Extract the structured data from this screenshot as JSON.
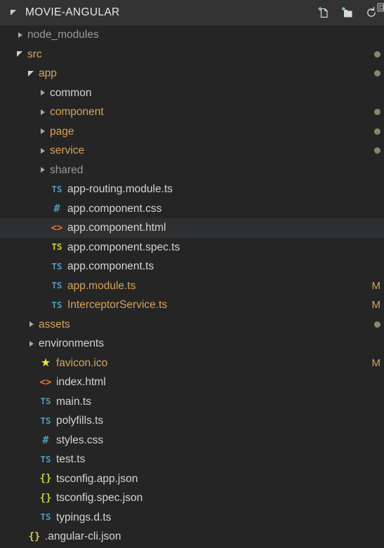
{
  "header": {
    "title": "MOVIE-ANGULAR",
    "twisty": "expanded-twisty-icon",
    "actions": [
      {
        "name": "new-file-icon",
        "label": "New File"
      },
      {
        "name": "new-folder-icon",
        "label": "New Folder"
      },
      {
        "name": "refresh-icon",
        "label": "Refresh Explorer"
      },
      {
        "name": "collapse-all-icon",
        "label": "Collapse Folders in Explorer"
      }
    ]
  },
  "tree": {
    "rows": [
      {
        "label": "node_modules",
        "indent": 1,
        "twisty": "collapsed",
        "icon": "",
        "color": "c-dim",
        "badge": "",
        "dot": false
      },
      {
        "label": "src",
        "indent": 1,
        "twisty": "expanded",
        "icon": "",
        "color": "c-modified",
        "badge": "",
        "dot": true
      },
      {
        "label": "app",
        "indent": 2,
        "twisty": "expanded",
        "icon": "",
        "color": "c-modified",
        "badge": "",
        "dot": true
      },
      {
        "label": "common",
        "indent": 3,
        "twisty": "collapsed",
        "icon": "",
        "color": "c-plain",
        "badge": "",
        "dot": false
      },
      {
        "label": "component",
        "indent": 3,
        "twisty": "collapsed",
        "icon": "",
        "color": "c-modified",
        "badge": "",
        "dot": true
      },
      {
        "label": "page",
        "indent": 3,
        "twisty": "collapsed",
        "icon": "",
        "color": "c-modified",
        "badge": "",
        "dot": true
      },
      {
        "label": "service",
        "indent": 3,
        "twisty": "collapsed",
        "icon": "",
        "color": "c-modified",
        "badge": "",
        "dot": true
      },
      {
        "label": "shared",
        "indent": 3,
        "twisty": "collapsed",
        "icon": "",
        "color": "c-dim",
        "badge": "",
        "dot": false
      },
      {
        "label": "app-routing.module.ts",
        "indent": 3,
        "twisty": "none",
        "icon": "ts",
        "color": "c-plain",
        "badge": "",
        "dot": false
      },
      {
        "label": "app.component.css",
        "indent": 3,
        "twisty": "none",
        "icon": "css",
        "color": "c-plain",
        "badge": "",
        "dot": false
      },
      {
        "label": "app.component.html",
        "indent": 3,
        "twisty": "none",
        "icon": "html",
        "color": "c-plain",
        "badge": "",
        "dot": false,
        "selected": true
      },
      {
        "label": "app.component.spec.ts",
        "indent": 3,
        "twisty": "none",
        "icon": "tsy",
        "color": "c-plain",
        "badge": "",
        "dot": false
      },
      {
        "label": "app.component.ts",
        "indent": 3,
        "twisty": "none",
        "icon": "ts",
        "color": "c-plain",
        "badge": "",
        "dot": false
      },
      {
        "label": "app.module.ts",
        "indent": 3,
        "twisty": "none",
        "icon": "ts",
        "color": "c-modified",
        "badge": "M",
        "dot": false
      },
      {
        "label": "InterceptorService.ts",
        "indent": 3,
        "twisty": "none",
        "icon": "ts",
        "color": "c-modified",
        "badge": "M",
        "dot": false
      },
      {
        "label": "assets",
        "indent": 2,
        "twisty": "collapsed",
        "icon": "",
        "color": "c-modified",
        "badge": "",
        "dot": true
      },
      {
        "label": "environments",
        "indent": 2,
        "twisty": "collapsed",
        "icon": "",
        "color": "c-plain",
        "badge": "",
        "dot": false
      },
      {
        "label": "favicon.ico",
        "indent": 2,
        "twisty": "none",
        "icon": "star",
        "color": "c-modified",
        "badge": "M",
        "dot": false
      },
      {
        "label": "index.html",
        "indent": 2,
        "twisty": "none",
        "icon": "html",
        "color": "c-plain",
        "badge": "",
        "dot": false
      },
      {
        "label": "main.ts",
        "indent": 2,
        "twisty": "none",
        "icon": "ts",
        "color": "c-plain",
        "badge": "",
        "dot": false
      },
      {
        "label": "polyfills.ts",
        "indent": 2,
        "twisty": "none",
        "icon": "ts",
        "color": "c-plain",
        "badge": "",
        "dot": false
      },
      {
        "label": "styles.css",
        "indent": 2,
        "twisty": "none",
        "icon": "css",
        "color": "c-plain",
        "badge": "",
        "dot": false
      },
      {
        "label": "test.ts",
        "indent": 2,
        "twisty": "none",
        "icon": "ts",
        "color": "c-plain",
        "badge": "",
        "dot": false
      },
      {
        "label": "tsconfig.app.json",
        "indent": 2,
        "twisty": "none",
        "icon": "json",
        "color": "c-plain",
        "badge": "",
        "dot": false
      },
      {
        "label": "tsconfig.spec.json",
        "indent": 2,
        "twisty": "none",
        "icon": "json",
        "color": "c-plain",
        "badge": "",
        "dot": false
      },
      {
        "label": "typings.d.ts",
        "indent": 2,
        "twisty": "none",
        "icon": "ts",
        "color": "c-plain",
        "badge": "",
        "dot": false
      },
      {
        "label": ".angular-cli.json",
        "indent": 1,
        "twisty": "none",
        "icon": "json",
        "color": "c-plain",
        "badge": "",
        "dot": false
      }
    ],
    "icon_glyphs": {
      "ts": "TS",
      "tsy": "TS",
      "css": "#",
      "html": "<>",
      "json": "{}",
      "star": "★"
    }
  },
  "colors": {
    "header_bg": "#333333",
    "tree_bg": "#252526",
    "selected_row_bg": "#2d2f30",
    "text": "#d4d4d4",
    "text_dim": "#9a9a9a",
    "modified": "#d5a458",
    "icon_ts_blue": "#519aba",
    "icon_yellow": "#cbcb41",
    "icon_orange": "#e37933",
    "icon_star": "#e8e845",
    "badge_dot": "#8c8567",
    "action_accent": "#89d185"
  }
}
